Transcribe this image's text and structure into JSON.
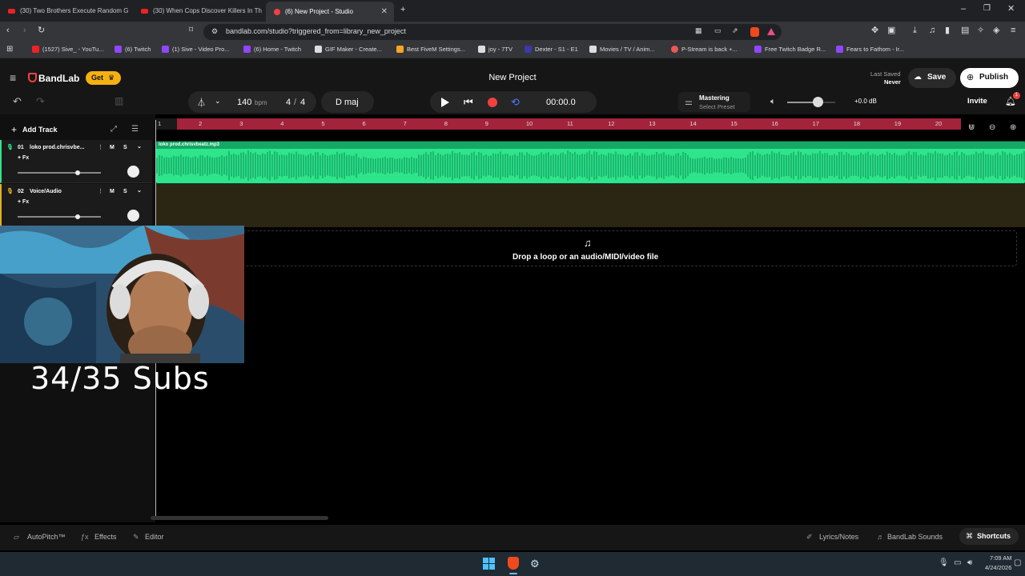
{
  "tabs": [
    {
      "title": "(30) Two Brothers Execute Random G"
    },
    {
      "title": "(30) When Cops Discover Killers In Th"
    },
    {
      "title": "(6) New Project - Studio"
    }
  ],
  "address": {
    "url": "bandlab.com/studio?triggered_from=library_new_project"
  },
  "bookmarks": [
    {
      "label": "(1527) Sive_ - YouTu...",
      "color": "#e22"
    },
    {
      "label": "(6) Twitch",
      "color": "#9146ff"
    },
    {
      "label": "(1) Sive - Video Pro...",
      "color": "#9146ff"
    },
    {
      "label": "(6) Home - Twitch",
      "color": "#9146ff"
    },
    {
      "label": "GIF Maker - Create...",
      "color": "#ddd"
    },
    {
      "label": "Best FiveM Settings...",
      "color": "#f5a623"
    },
    {
      "label": "joy - 7TV",
      "color": "#ddd"
    },
    {
      "label": "Dexter - S1 - E1",
      "color": "#1d1d6b"
    },
    {
      "label": "Movies / TV / Anim...",
      "color": "#ddd"
    },
    {
      "label": "P-Stream is back +...",
      "color": "#e55"
    },
    {
      "label": "Free Twitch Badge R...",
      "color": "#9146ff"
    },
    {
      "label": "Fears to Fathom - Ir...",
      "color": "#9146ff"
    }
  ],
  "app": {
    "brand": "BandLab",
    "get_label": "Get",
    "project_title": "New Project",
    "last_saved_label": "Last Saved",
    "last_saved_value": "Never",
    "save_label": "Save",
    "publish_label": "Publish",
    "invite_label": "Invite",
    "notification_count": "1"
  },
  "toolbar": {
    "tempo": "140",
    "tempo_unit": "bpm",
    "time_sig_num": "4",
    "time_sig_sep": "/",
    "time_sig_den": "4",
    "key": "D maj",
    "time": "00:00.0",
    "mastering_label": "Mastering",
    "mastering_preset": "Select Preset",
    "volume_db": "+0.0 dB",
    "volume_level": 0.63
  },
  "tracks_panel": {
    "add_track_label": "Add Track"
  },
  "tracks": [
    {
      "num": "01",
      "name": "loko prod.chrisvbe...",
      "fx": "+ Fx",
      "mute": "M",
      "solo": "S",
      "volume": 0.72
    },
    {
      "num": "02",
      "name": "Voice/Audio",
      "fx": "+ Fx",
      "mute": "M",
      "solo": "S",
      "volume": 0.72
    }
  ],
  "ruler": [
    "1",
    "2",
    "3",
    "4",
    "5",
    "6",
    "7",
    "8",
    "9",
    "10",
    "11",
    "12",
    "13",
    "14",
    "15",
    "16",
    "17",
    "18",
    "19",
    "20"
  ],
  "clip": {
    "name": "loko prod.chrisvbeatz.mp3"
  },
  "drop_zone": {
    "text": "Drop a loop or an audio/MIDI/video file"
  },
  "overlay": {
    "subs_text": "34/35 Subs"
  },
  "bottom": {
    "autopitch": "AutoPitch™",
    "effects": "Effects",
    "editor": "Editor",
    "lyrics": "Lyrics/Notes",
    "sounds": "BandLab Sounds",
    "shortcuts": "Shortcuts"
  },
  "taskbar": {
    "time": "7:09 AM",
    "date": "4/24/2026"
  },
  "colors": {
    "accent_red": "#f24141",
    "clip_green": "#2ee58b",
    "loop_band": "#a3233a",
    "get_badge": "#f5b013"
  }
}
